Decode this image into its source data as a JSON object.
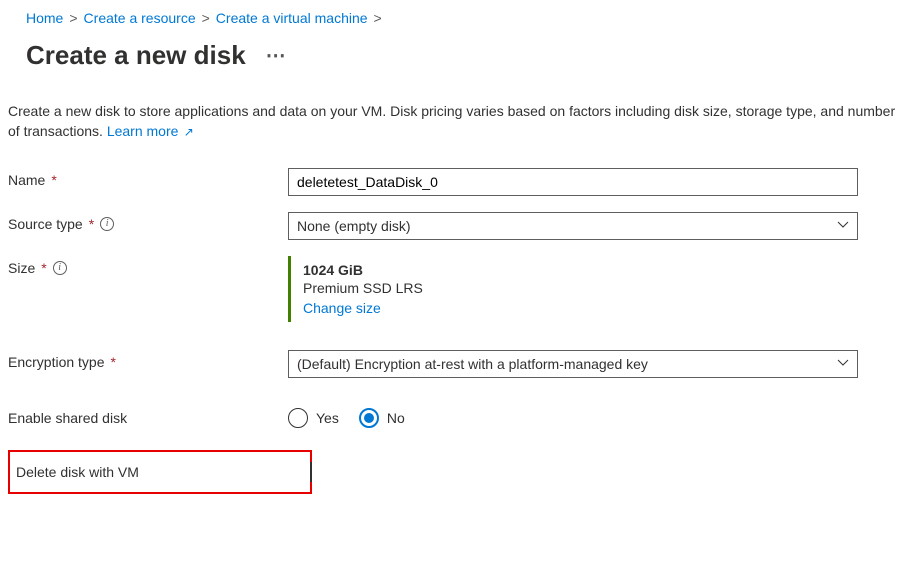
{
  "breadcrumb": {
    "items": [
      {
        "label": "Home"
      },
      {
        "label": "Create a resource"
      },
      {
        "label": "Create a virtual machine"
      }
    ]
  },
  "page": {
    "title": "Create a new disk"
  },
  "intro": {
    "text": "Create a new disk to store applications and data on your VM. Disk pricing varies based on factors including disk size, storage type, and number of transactions. ",
    "learn_more": "Learn more"
  },
  "fields": {
    "name": {
      "label": "Name",
      "value": "deletetest_DataDisk_0"
    },
    "source_type": {
      "label": "Source type",
      "value": "None (empty disk)"
    },
    "size": {
      "label": "Size",
      "value": "1024 GiB",
      "tier": "Premium SSD LRS",
      "change": "Change size"
    },
    "encryption": {
      "label": "Encryption type",
      "value": "(Default) Encryption at-rest with a platform-managed key"
    },
    "shared": {
      "label": "Enable shared disk",
      "yes": "Yes",
      "no": "No",
      "selected": "no"
    },
    "delete_with_vm": {
      "label": "Delete disk with VM",
      "checked": false
    }
  }
}
